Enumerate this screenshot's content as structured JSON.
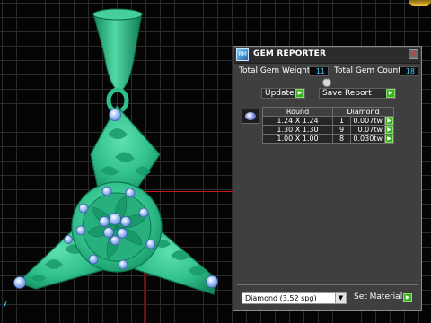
{
  "viewport": {
    "axis_label": "y"
  },
  "gem_reporter": {
    "title": "GEM REPORTER",
    "logo_text": "RM",
    "close_label": "×",
    "total_weight_label": "Total Gem Weight",
    "total_weight_value": "11",
    "total_count_label": "Total Gem Count",
    "total_count_value": "18",
    "update_label": "Update",
    "save_report_label": "Save Report",
    "table_headers": {
      "size": "Round",
      "type": "Diamond"
    },
    "rows": [
      {
        "size": "1.24 X 1.24",
        "count": "1",
        "weight": "0.007tw"
      },
      {
        "size": "1.30 X 1.30",
        "count": "9",
        "weight": "0.07tw"
      },
      {
        "size": "1.00 X 1.00",
        "count": "8",
        "weight": "0.030tw"
      }
    ],
    "material_value": "Diamond    (3.52 spg)",
    "set_material_label": "Set Material"
  },
  "colors": {
    "metal": "#2fbf8a",
    "metal_dark": "#138a5e",
    "gem": "#8fb4f0",
    "accent_green": "#3ab022",
    "value_text": "#4ed0ff"
  }
}
